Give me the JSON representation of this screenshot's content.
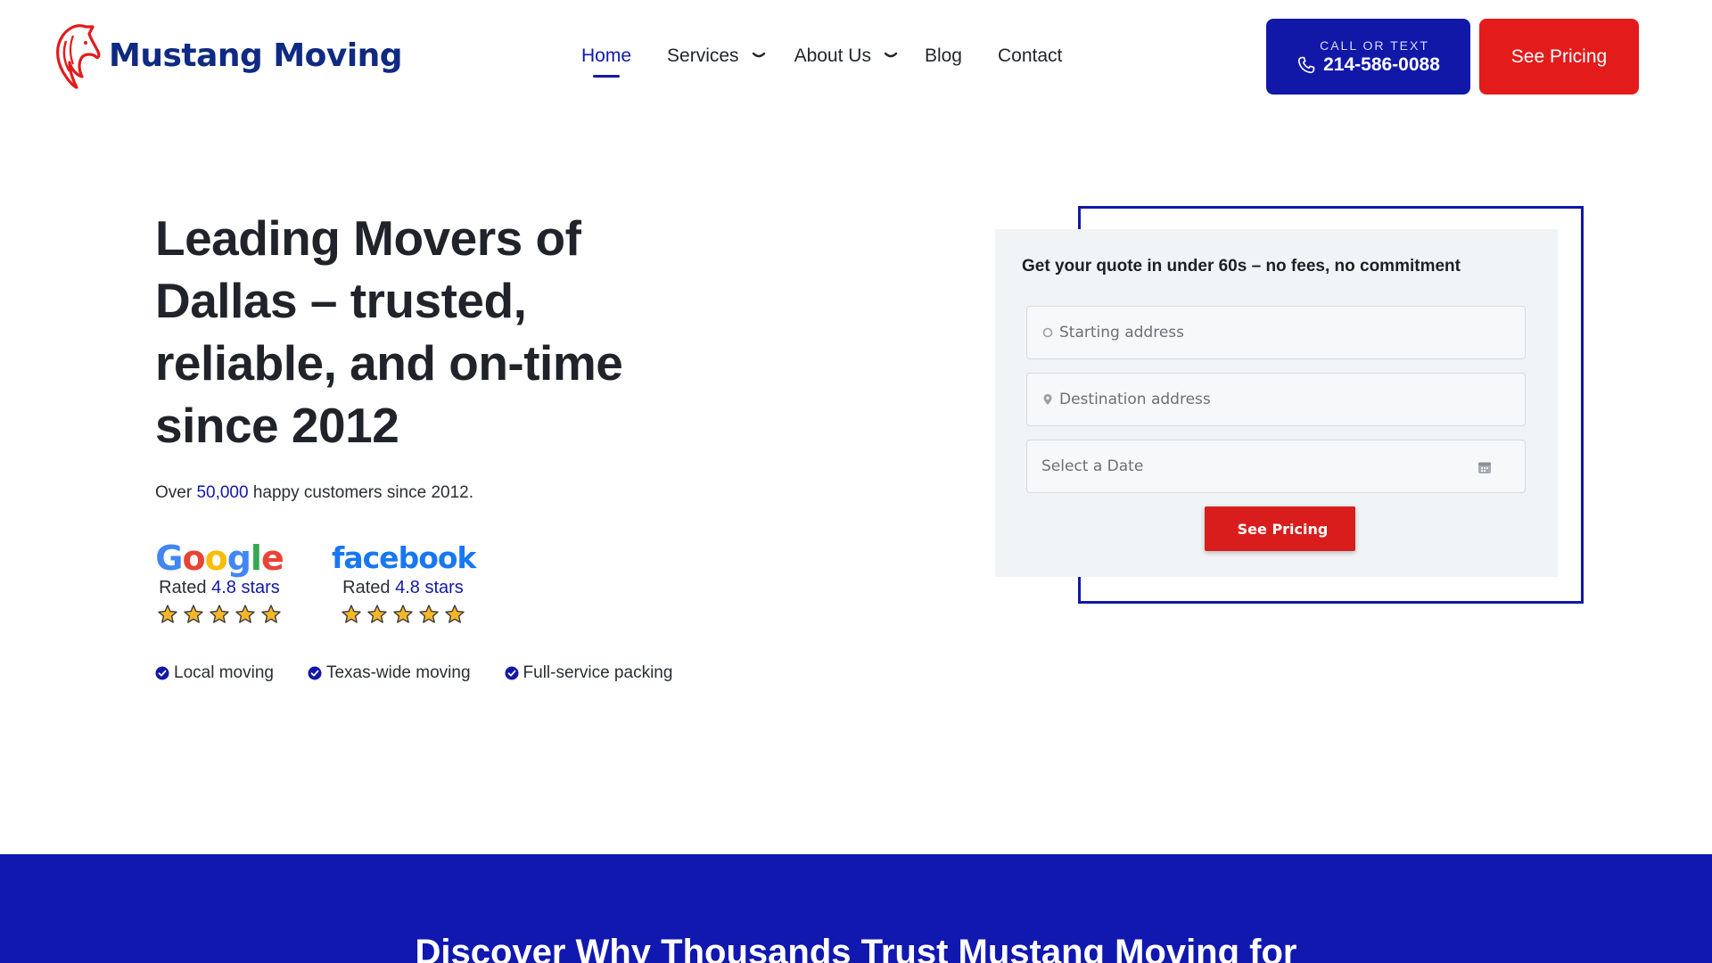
{
  "brand": {
    "name": "Mustang Moving",
    "color": "#0f2a82",
    "logo_icon": "horse-head-icon"
  },
  "nav": {
    "items": [
      {
        "label": "Home",
        "active": true
      },
      {
        "label": "Services",
        "dropdown": true
      },
      {
        "label": "About Us",
        "dropdown": true
      },
      {
        "label": "Blog"
      },
      {
        "label": "Contact"
      }
    ]
  },
  "cta": {
    "call_small": "CALL OR TEXT",
    "call_number": "214-586-0088",
    "call_icon": "phone-icon",
    "pricing_label": "See Pricing",
    "primary_color": "#1118a8",
    "accent_color": "#e31b1b"
  },
  "hero": {
    "title": "Leading Movers of Dallas – trusted, reliable, and on-time since 2012",
    "sub_prefix": "Over ",
    "sub_highlight": "50,000",
    "sub_suffix": " happy customers since 2012."
  },
  "ratings": [
    {
      "brand": "Google",
      "rated_prefix": "Rated ",
      "rated_value": "4.8 stars",
      "stars": 5
    },
    {
      "brand": "facebook",
      "rated_prefix": "Rated ",
      "rated_value": "4.8 stars",
      "stars": 5
    }
  ],
  "features": [
    "Local moving",
    "Texas-wide moving",
    "Full-service packing"
  ],
  "quote_form": {
    "title": "Get your quote in under 60s – no fees, no commitment",
    "start_placeholder": "Starting address",
    "destination_placeholder": "Destination address",
    "date_placeholder": "Select a Date",
    "submit_label": "See Pricing",
    "submit_glyph": ""
  },
  "section": {
    "title": "Discover Why Thousands Trust Mustang Moving for"
  }
}
